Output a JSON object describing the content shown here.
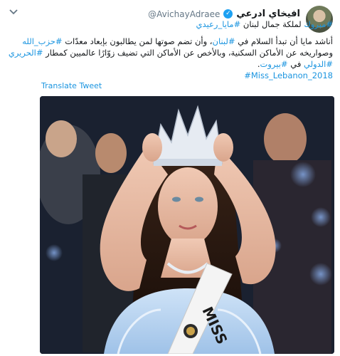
{
  "author": {
    "name": "افيخاي ادرعي",
    "handle": "@AvichayAdraee",
    "verified_icon": "verified-badge-icon",
    "avatar_icon": "profile-avatar-icon"
  },
  "tweet": {
    "line1_hashtag": "#مبروك",
    "line1_text": " لملكة جمال لبنان ",
    "line1_hashtag2": "#مايا_رعيدي",
    "p2_a": "أناشد مايا أن تبدأ السلام في ",
    "p2_tag1": "#لبنان",
    "p2_b": "، وأن تضم صوتها لمن يطالبون بإبعاد معدّات ",
    "p2_tag2": "#حزب_الله",
    "p2_c": " وصواريخه عن الأماكن السكنية، وبالأخص عن الأماكن التي تضيف زوّارًا عالميين كمطار ",
    "p2_tag3": "#الحريري",
    "p2_tag4": "#الدولي",
    "p2_d": " في ",
    "p2_tag5": "#بيروت",
    "p2_end": ".",
    "p3_tag": "#Miss_Lebanon_2018"
  },
  "translate_label": "Translate Tweet",
  "photo": {
    "sash_text": "MISS",
    "description_icon": "miss-lebanon-photo"
  },
  "colors": {
    "hashtag": "#1b95e0",
    "text": "#14171a",
    "muted": "#657786",
    "verified": "#1da1f2"
  }
}
